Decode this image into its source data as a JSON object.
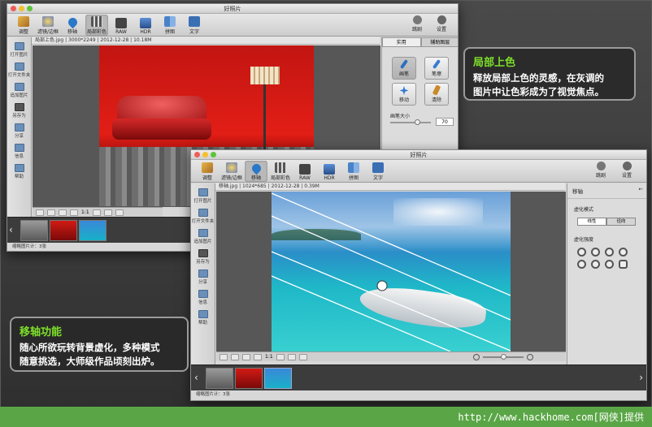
{
  "app_title": "好照片",
  "toolbar_items": [
    {
      "label": "调整",
      "icon": "pencil-icon"
    },
    {
      "label": "滤镜/边框",
      "icon": "palette-icon"
    },
    {
      "label": "移轴",
      "icon": "drop-icon"
    },
    {
      "label": "局部彩色",
      "icon": "grid-icon"
    },
    {
      "label": "RAW",
      "icon": "camera-icon"
    },
    {
      "label": "HDR",
      "icon": "hdr-icon"
    },
    {
      "label": "拼图",
      "icon": "collage-icon"
    },
    {
      "label": "文字",
      "icon": "text-icon"
    }
  ],
  "toolbar_right": {
    "adjust_label": "跳剧",
    "settings_label": "设置"
  },
  "sidebar_items": [
    "打开图片",
    "打开文件夹",
    "追加图片",
    "另存为",
    "分享",
    "信息",
    "帮助"
  ],
  "win1": {
    "info": "局部上色.jpg | 3000*2249 | 2012-12-28 | 10.18M",
    "panel_tabs": [
      "实用",
      "辅助图层"
    ],
    "brush_buttons": [
      "画笔",
      "笔擦",
      "移动",
      "清除"
    ],
    "brush_size_label": "画笔大小",
    "brush_size_value": "70",
    "status": "缩略图片计：3张"
  },
  "win2": {
    "info": "移轴.jpg | 1024*685 | 2012-12-28 | 0.39M",
    "panel_title": "移轴",
    "blur_mode_label": "虚化模式",
    "mode_options": [
      "线性",
      "径向"
    ],
    "blur_strength_label": "虚化强度",
    "status": "缩略图片计：3张"
  },
  "zoom_label": "1:1",
  "callout_local_color": {
    "title": "局部上色",
    "lines": [
      "释放局部上色的灵感，在灰调的",
      "图片中让色彩成为了视觉焦点。"
    ]
  },
  "callout_tilt_shift": {
    "title": "移轴功能",
    "lines": [
      "随心所欲玩转背景虚化，多种模式",
      "随意挑选，大师级作品顷刻出炉。"
    ]
  },
  "site_caption": "http://www.hackhome.com[网侠]提供",
  "colors": {
    "accent_green": "#7ee02a",
    "bottom_bar": "#5aa646"
  }
}
